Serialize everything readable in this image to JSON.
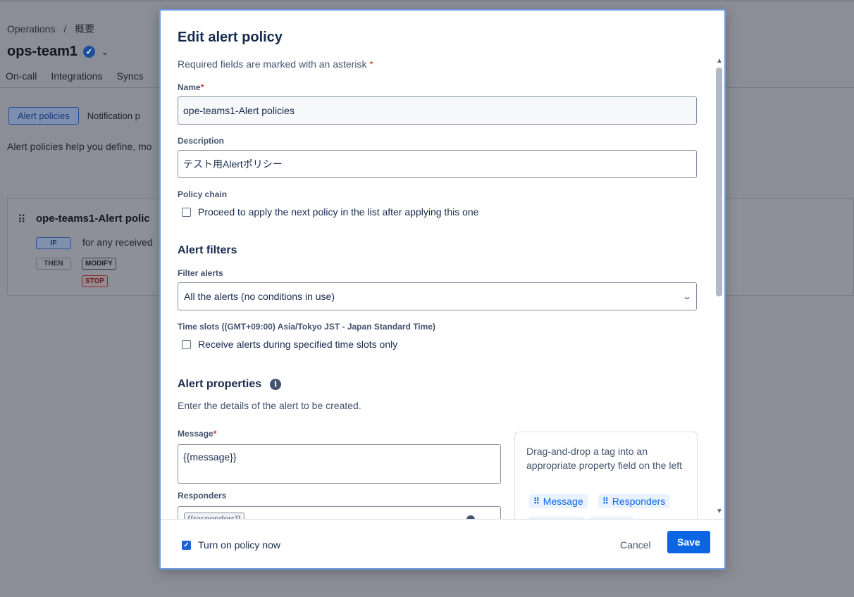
{
  "background": {
    "breadcrumb": {
      "parent": "Operations",
      "separator": "/",
      "current": "概要"
    },
    "team_name": "ops-team1",
    "tabs": [
      "On-call",
      "Integrations",
      "Syncs"
    ],
    "subtabs": {
      "active": "Alert policies",
      "other": "Notification p"
    },
    "description": "Alert policies help you define, mo",
    "policy_card": {
      "title": "ope-teams1-Alert polic",
      "if_badge": "IF",
      "if_text": "for any received",
      "then_badge": "THEN",
      "modify_badge": "MODIFY",
      "stop_badge": "STOP"
    }
  },
  "modal": {
    "title": "Edit alert policy",
    "required_note": "Required fields are marked with an asterisk",
    "asterisk": "*",
    "name_label": "Name",
    "name_value": "ope-teams1-Alert policies",
    "description_label": "Description",
    "description_value": "テスト用Alertポリシー",
    "policy_chain_label": "Policy chain",
    "policy_chain_checkbox": "Proceed to apply the next policy in the list after applying this one",
    "alert_filters_heading": "Alert filters",
    "filter_alerts_label": "Filter alerts",
    "filter_alerts_value": "All the alerts (no conditions in use)",
    "time_slots_label": "Time slots ((GMT+09:00) Asia/Tokyo JST - Japan Standard Time)",
    "time_slots_checkbox": "Receive alerts during specified time slots only",
    "alert_properties_heading": "Alert properties",
    "alert_properties_desc": "Enter the details of the alert to be created.",
    "message_label": "Message",
    "message_value": "{{message}}",
    "responders_label": "Responders",
    "responders_chip": "{{responders}}",
    "tag_hint": "Drag-and-drop a tag into an appropriate property field on the left",
    "tags": [
      "Message",
      "Responders"
    ]
  },
  "footer": {
    "turn_on_label": "Turn on policy now",
    "turn_on_checked": true,
    "cancel_label": "Cancel",
    "save_label": "Save"
  },
  "colors": {
    "primary": "#0c66e4",
    "asterisk": "#c9372c",
    "modal_border": "#6f9be5"
  }
}
